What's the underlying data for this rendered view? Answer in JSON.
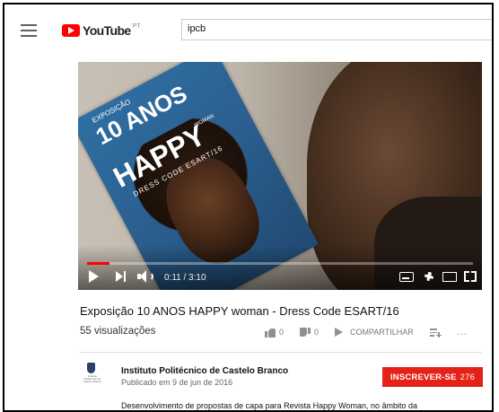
{
  "header": {
    "logo_text": "YouTube",
    "country_code": "PT",
    "search_value": "ipcb"
  },
  "video": {
    "magazine_lines": [
      "EXPOSIÇÃO",
      "10 ANOS",
      "HAPPY",
      "DRESS CODE ESART/16",
      "WOMAN"
    ],
    "current_time": "0:11",
    "duration": "3:10",
    "time_display": "0:11 / 3:10",
    "progress_fraction": 0.0579
  },
  "info": {
    "title": "Exposição 10 ANOS HAPPY woman - Dress Code ESART/16",
    "views": "55 visualizações",
    "likes": "0",
    "dislikes": "0",
    "share_label": "COMPARTILHAR",
    "more_label": "..."
  },
  "channel": {
    "name": "Instituto Politécnico de Castelo Branco",
    "published": "Publicado em 9 de jun de 2016",
    "logo_caption": "Instituto Politécnico de Castelo Branco",
    "subscribe_label": "INSCREVER-SE",
    "subscriber_count": "276"
  },
  "description": {
    "text": "Desenvolvimento de propostas de capa para Revista Happy Woman, no âmbito da"
  },
  "colors": {
    "brand_red": "#ff0000",
    "subscribe_red": "#e62117",
    "icon_gray": "#909090"
  }
}
